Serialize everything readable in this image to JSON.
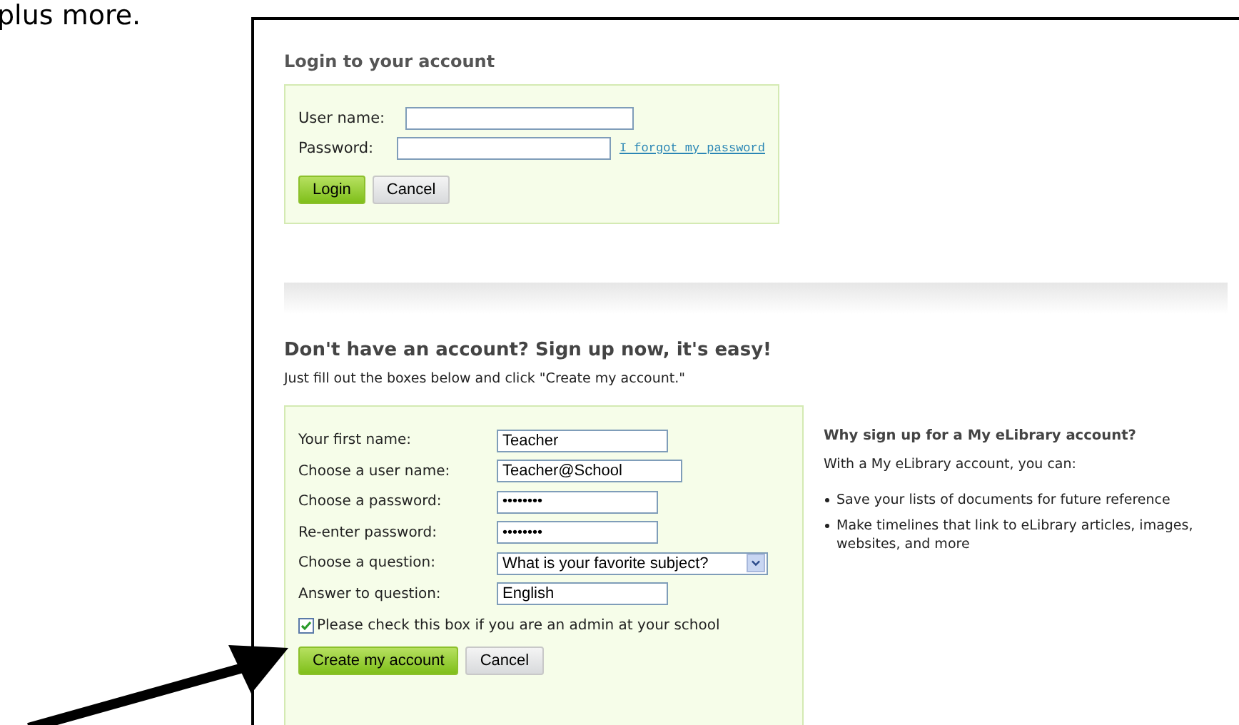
{
  "doc_text": "plus more.",
  "login": {
    "title": "Login to your account",
    "fields": [
      {
        "label": "User name:"
      },
      {
        "label": "Password:",
        "link": "I forgot my password"
      }
    ],
    "buttons": [
      {
        "label": "Login",
        "kind": "primary"
      },
      {
        "label": "Cancel",
        "kind": "secondary"
      }
    ]
  },
  "signup": {
    "title": "Don't have an account? Sign up now, it's easy!",
    "subtitle": "Just fill out the boxes below and click \"Create my account.\"",
    "fields": [
      {
        "label": "Your first name:",
        "value": "Teacher",
        "kind": "text"
      },
      {
        "label": "Choose a user name:",
        "value": "Teacher@School",
        "kind": "text"
      },
      {
        "label": "Choose a password:",
        "value": "••••••••",
        "kind": "password"
      },
      {
        "label": "Re-enter password:",
        "value": "••••••••",
        "kind": "password"
      },
      {
        "label": "Choose a question:",
        "value": "What is your favorite subject?",
        "kind": "select"
      },
      {
        "label": "Answer to question:",
        "value": "English",
        "kind": "text"
      }
    ],
    "admin_checkbox": {
      "label": "Please check this box if you are an admin at your school",
      "checked": true
    },
    "buttons": [
      {
        "label": "Create my account",
        "kind": "primary"
      },
      {
        "label": "Cancel",
        "kind": "secondary"
      }
    ]
  },
  "why": {
    "title": "Why sign up for a My eLibrary account?",
    "intro": "With a My eLibrary account, you can:",
    "items": [
      "Save your lists of documents for future reference",
      "Make timelines that link to eLibrary articles, images, websites, and more"
    ]
  }
}
